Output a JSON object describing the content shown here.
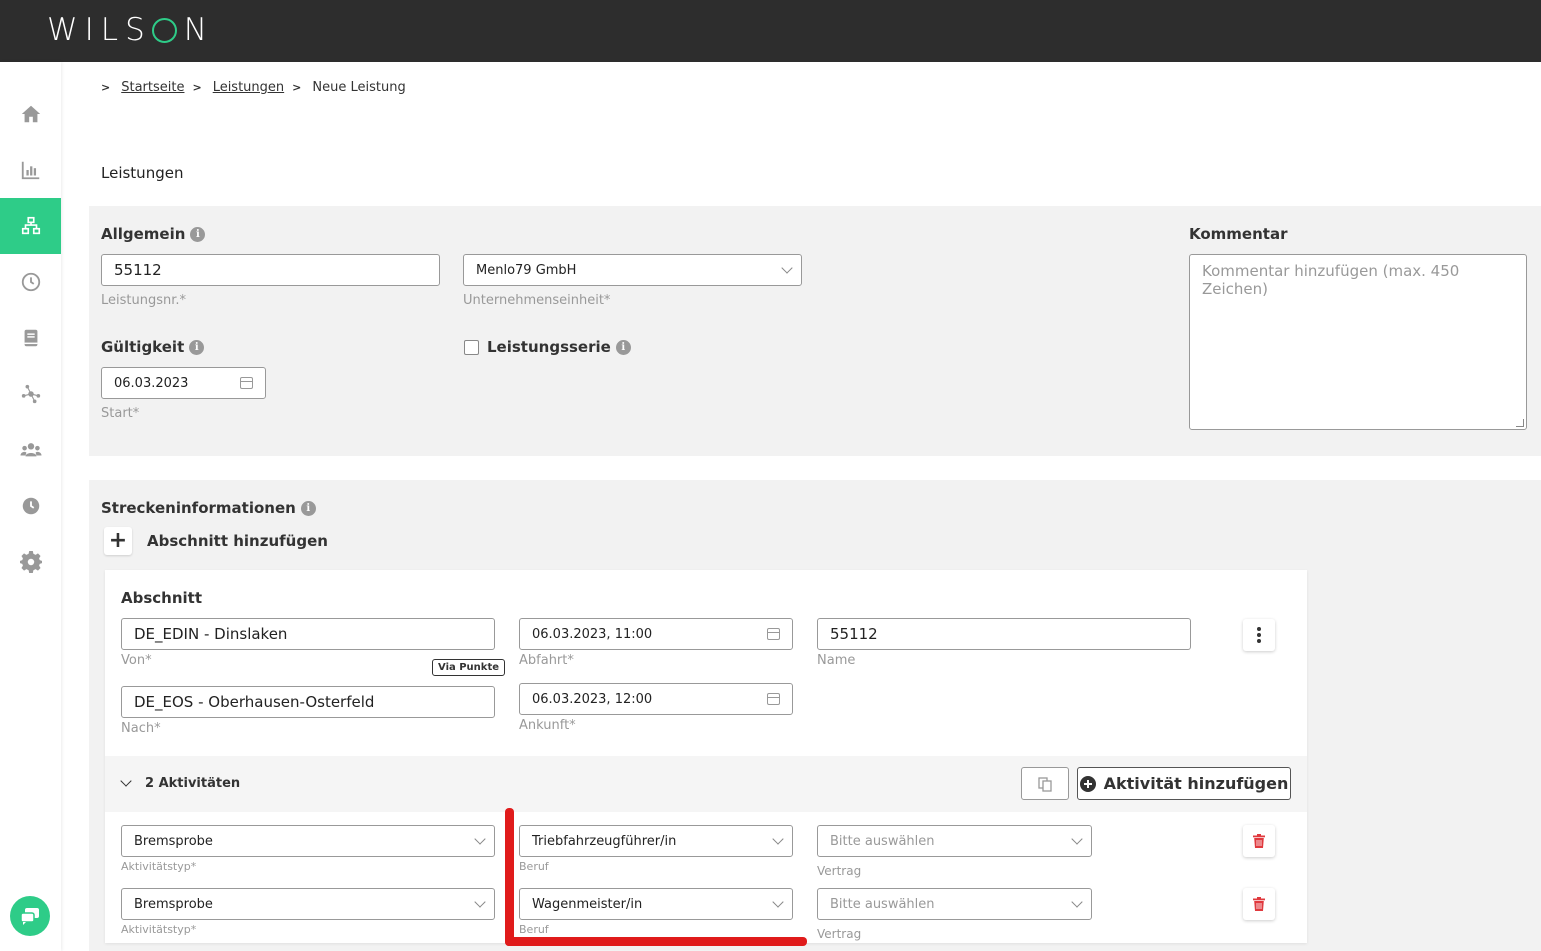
{
  "app": {
    "logo": "WILSON"
  },
  "sidebar": {
    "items": [
      {
        "name": "home-icon",
        "active": false
      },
      {
        "name": "chart-icon",
        "active": false
      },
      {
        "name": "network-icon",
        "active": true
      },
      {
        "name": "clock-icon",
        "active": false
      },
      {
        "name": "book-icon",
        "active": false
      },
      {
        "name": "nodes-icon",
        "active": false
      },
      {
        "name": "users-icon",
        "active": false
      },
      {
        "name": "history-icon",
        "active": false
      },
      {
        "name": "gear-icon",
        "active": false
      }
    ]
  },
  "breadcrumb": {
    "items": [
      "Startseite",
      "Leistungen"
    ],
    "current": "Neue Leistung"
  },
  "page": {
    "title": "Leistungen"
  },
  "allgemein": {
    "heading": "Allgemein",
    "leistungsnr_value": "55112",
    "leistungsnr_label": "Leistungsnr.*",
    "unternehmenseinheit_value": "Menlo79 GmbH",
    "unternehmenseinheit_label": "Unternehmenseinheit*",
    "gueltigkeit_heading": "Gültigkeit",
    "start_value": "06.03.2023",
    "start_label": "Start*",
    "leistungsserie_label": "Leistungsserie",
    "kommentar_heading": "Kommentar",
    "kommentar_placeholder": "Kommentar hinzufügen (max. 450 Zeichen)"
  },
  "strecke": {
    "heading": "Streckeninformationen",
    "add_section_label": "Abschnitt hinzufügen",
    "section": {
      "heading": "Abschnitt",
      "von_value": "DE_EDIN - Dinslaken",
      "von_label": "Von*",
      "via_label": "Via Punkte",
      "nach_value": "DE_EOS - Oberhausen-Osterfeld",
      "nach_label": "Nach*",
      "abfahrt_value": "06.03.2023, 11:00",
      "abfahrt_label": "Abfahrt*",
      "ankunft_value": "06.03.2023, 12:00",
      "ankunft_label": "Ankunft*",
      "name_value": "55112",
      "name_label": "Name"
    },
    "activities": {
      "heading": "2 Aktivitäten",
      "add_label": "Aktivität hinzufügen",
      "rows": [
        {
          "typ": "Bremsprobe",
          "typ_label": "Aktivitätstyp*",
          "beruf": "Triebfahrzeugführer/in",
          "beruf_label": "Beruf",
          "vertrag": "Bitte auswählen",
          "vertrag_label": "Vertrag"
        },
        {
          "typ": "Bremsprobe",
          "typ_label": "Aktivitätstyp*",
          "beruf": "Wagenmeister/in",
          "beruf_label": "Beruf",
          "vertrag": "Bitte auswählen",
          "vertrag_label": "Vertrag"
        }
      ]
    }
  },
  "colors": {
    "accent": "#2ecc88",
    "topbar": "#2d2d2d",
    "danger": "#e0393e",
    "annotation": "#e01b1b"
  }
}
